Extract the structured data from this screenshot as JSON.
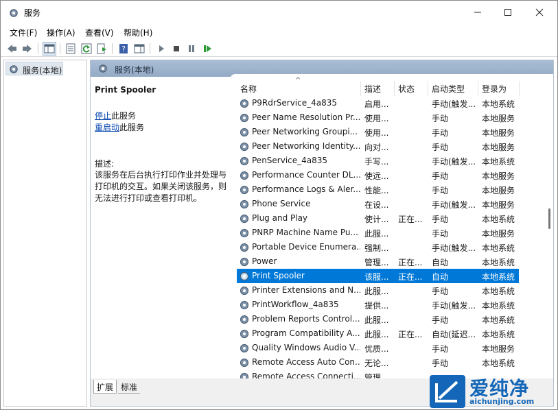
{
  "window": {
    "title": "服务"
  },
  "menu": [
    "文件(F)",
    "操作(A)",
    "查看(V)",
    "帮助(H)"
  ],
  "tree": {
    "root_label": "服务(本地)"
  },
  "main": {
    "header_label": "服务(本地)"
  },
  "details": {
    "service_name": "Print Spooler",
    "stop_link": "停止",
    "stop_suffix": "此服务",
    "restart_link": "重启动",
    "restart_suffix": "此服务",
    "desc_label": "描述:",
    "desc_text": "该服务在后台执行打印作业并处理与打印机的交互。如果关闭该服务，则无法进行打印或查看打印机。"
  },
  "columns": {
    "name": "名称",
    "desc": "描述",
    "status": "状态",
    "start": "启动类型",
    "logon": "登录为"
  },
  "rows": [
    {
      "name": "P9RdrService_4a835",
      "desc": "启用...",
      "status": "",
      "start": "手动(触发...",
      "logon": "本地系统"
    },
    {
      "name": "Peer Name Resolution Pr...",
      "desc": "使用...",
      "status": "",
      "start": "手动",
      "logon": "本地服务"
    },
    {
      "name": "Peer Networking Groupi...",
      "desc": "使用...",
      "status": "",
      "start": "手动",
      "logon": "本地服务"
    },
    {
      "name": "Peer Networking Identity...",
      "desc": "向对...",
      "status": "",
      "start": "手动",
      "logon": "本地服务"
    },
    {
      "name": "PenService_4a835",
      "desc": "手写...",
      "status": "",
      "start": "手动(触发...",
      "logon": "本地系统"
    },
    {
      "name": "Performance Counter DL...",
      "desc": "使远...",
      "status": "",
      "start": "手动",
      "logon": "本地服务"
    },
    {
      "name": "Performance Logs & Aler...",
      "desc": "性能...",
      "status": "",
      "start": "手动",
      "logon": "本地服务"
    },
    {
      "name": "Phone Service",
      "desc": "在设...",
      "status": "",
      "start": "手动(触发...",
      "logon": "本地服务"
    },
    {
      "name": "Plug and Play",
      "desc": "使计...",
      "status": "正在...",
      "start": "手动",
      "logon": "本地系统"
    },
    {
      "name": "PNRP Machine Name Pu...",
      "desc": "此服...",
      "status": "",
      "start": "手动",
      "logon": "本地服务"
    },
    {
      "name": "Portable Device Enumera...",
      "desc": "强制...",
      "status": "",
      "start": "手动(触发...",
      "logon": "本地系统"
    },
    {
      "name": "Power",
      "desc": "管理...",
      "status": "正在...",
      "start": "自动",
      "logon": "本地系统"
    },
    {
      "name": "Print Spooler",
      "desc": "该服...",
      "status": "正在...",
      "start": "自动",
      "logon": "本地系统"
    },
    {
      "name": "Printer Extensions and N...",
      "desc": "此服...",
      "status": "",
      "start": "手动",
      "logon": "本地系统"
    },
    {
      "name": "PrintWorkflow_4a835",
      "desc": "提供...",
      "status": "",
      "start": "手动(触发...",
      "logon": "本地系统"
    },
    {
      "name": "Problem Reports Control...",
      "desc": "此服...",
      "status": "",
      "start": "手动",
      "logon": "本地系统"
    },
    {
      "name": "Program Compatibility A...",
      "desc": "此服...",
      "status": "正在...",
      "start": "自动(延迟...",
      "logon": "本地系统"
    },
    {
      "name": "Quality Windows Audio V...",
      "desc": "优质...",
      "status": "",
      "start": "手动",
      "logon": "本地服务"
    },
    {
      "name": "Remote Access Auto Con...",
      "desc": "无论...",
      "status": "",
      "start": "手动",
      "logon": "本地系统"
    },
    {
      "name": "Remote Access Connecti...",
      "desc": "管理...",
      "status": "",
      "start": "",
      "logon": ""
    }
  ],
  "selected_row": 12,
  "tabs": [
    "扩展",
    "标准"
  ],
  "watermark": {
    "brand": "爱纯净",
    "url": "aichunjing.com"
  }
}
